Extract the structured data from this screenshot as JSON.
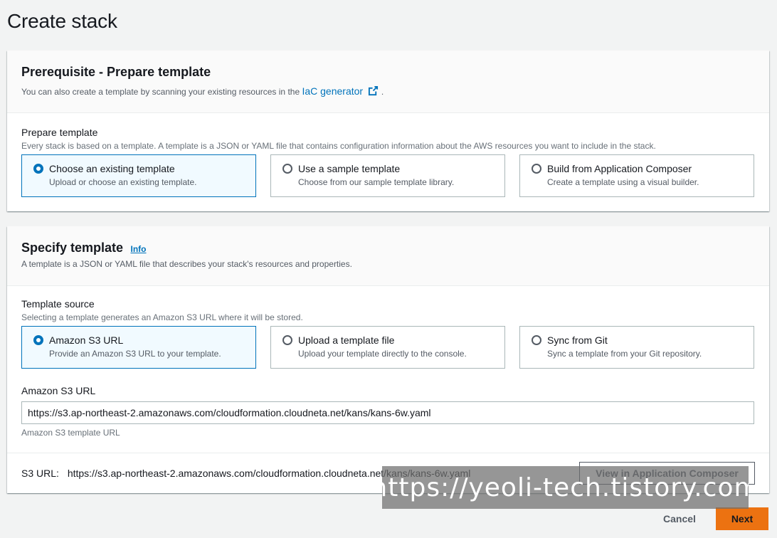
{
  "page": {
    "title": "Create stack"
  },
  "prerequisite": {
    "title": "Prerequisite - Prepare template",
    "description_prefix": "You can also create a template by scanning your existing resources in the",
    "iac_link_label": "IaC generator",
    "description_suffix": ".",
    "external_link_icon": "external-link-icon",
    "field_label": "Prepare template",
    "field_description": "Every stack is based on a template. A template is a JSON or YAML file that contains configuration information about the AWS resources you want to include in the stack.",
    "options": [
      {
        "title": "Choose an existing template",
        "description": "Upload or choose an existing template.",
        "selected": true
      },
      {
        "title": "Use a sample template",
        "description": "Choose from our sample template library.",
        "selected": false
      },
      {
        "title": "Build from Application Composer",
        "description": "Create a template using a visual builder.",
        "selected": false
      }
    ]
  },
  "specify": {
    "title": "Specify template",
    "info_label": "Info",
    "description": "A template is a JSON or YAML file that describes your stack's resources and properties.",
    "source_label": "Template source",
    "source_description": "Selecting a template generates an Amazon S3 URL where it will be stored.",
    "options": [
      {
        "title": "Amazon S3 URL",
        "description": "Provide an Amazon S3 URL to your template.",
        "selected": true
      },
      {
        "title": "Upload a template file",
        "description": "Upload your template directly to the console.",
        "selected": false
      },
      {
        "title": "Sync from Git",
        "description": "Sync a template from your Git repository.",
        "selected": false
      }
    ],
    "s3_url_label": "Amazon S3 URL",
    "s3_url_value": "https://s3.ap-northeast-2.amazonaws.com/cloudformation.cloudneta.net/kans/kans-6w.yaml",
    "s3_url_hint": "Amazon S3 template URL",
    "s3_summary_label": "S3 URL:",
    "s3_summary_value": "https://s3.ap-northeast-2.amazonaws.com/cloudformation.cloudneta.net/kans/kans-6w.yaml",
    "view_composer_label": "View in Application Composer"
  },
  "footer": {
    "cancel_label": "Cancel",
    "next_label": "Next"
  },
  "watermark": {
    "text": "https://yeoli-tech.tistory.com"
  },
  "colors": {
    "accent": "#0073bb",
    "primary_button": "#ec7211",
    "background": "#f2f3f3"
  }
}
